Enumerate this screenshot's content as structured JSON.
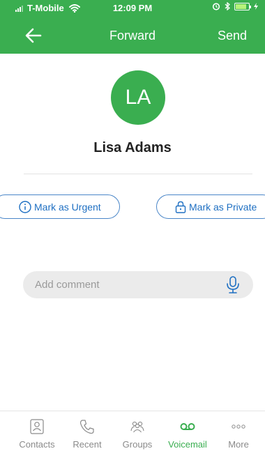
{
  "status_bar": {
    "carrier": "T-Mobile",
    "time": "12:09 PM"
  },
  "nav": {
    "title": "Forward",
    "send_label": "Send"
  },
  "contact": {
    "initials": "LA",
    "name": "Lisa Adams"
  },
  "actions": {
    "urgent_label": "Mark as Urgent",
    "private_label": "Mark as Private"
  },
  "comment": {
    "placeholder": "Add comment"
  },
  "tabs": [
    {
      "label": "Contacts",
      "icon": "contacts-icon"
    },
    {
      "label": "Recent",
      "icon": "phone-icon"
    },
    {
      "label": "Groups",
      "icon": "groups-icon"
    },
    {
      "label": "Voicemail",
      "icon": "voicemail-icon"
    },
    {
      "label": "More",
      "icon": "more-icon"
    }
  ],
  "active_tab": "Voicemail",
  "colors": {
    "brand_green": "#3aae50",
    "link_blue": "#1e6fc2"
  }
}
